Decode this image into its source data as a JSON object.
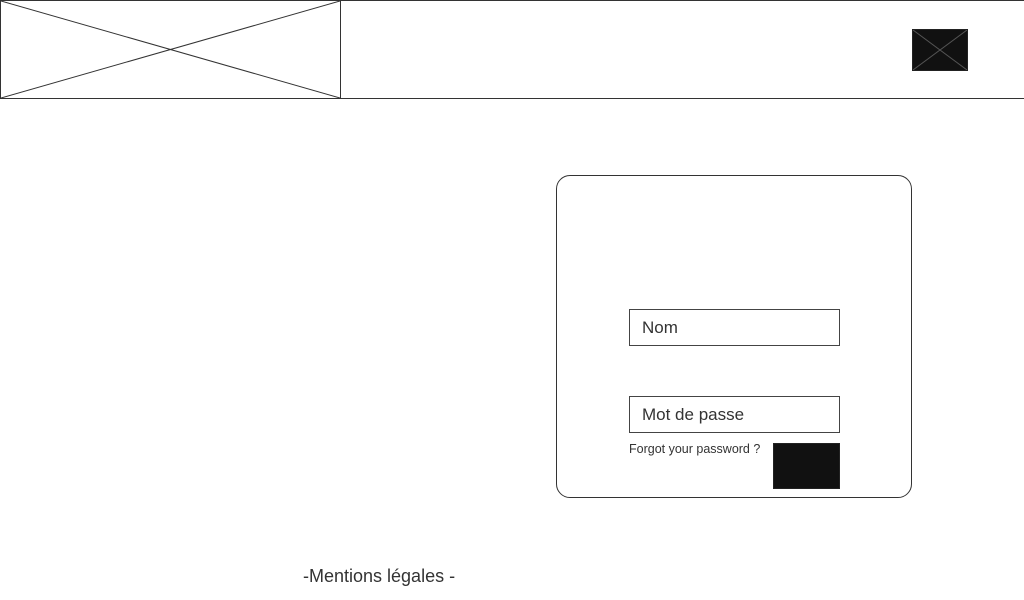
{
  "header": {
    "logo_icon": "image-placeholder-icon",
    "action_icon": "image-placeholder-icon"
  },
  "login": {
    "name_placeholder": "Nom",
    "password_placeholder": "Mot de passe",
    "forgot_label": "Forgot your password ?",
    "submit_label": ""
  },
  "footer": {
    "legal_label": "-Mentions légales -"
  },
  "colors": {
    "border": "#333333",
    "button_fill": "#111111",
    "background": "#ffffff"
  }
}
